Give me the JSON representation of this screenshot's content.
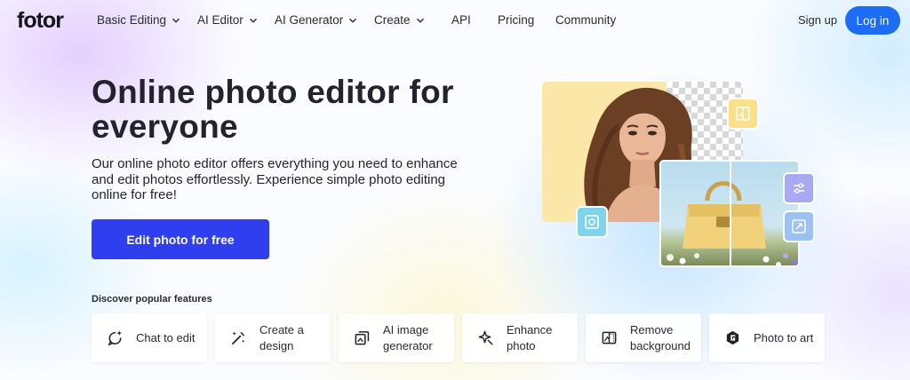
{
  "nav": {
    "logo": "fotor",
    "items": [
      {
        "label": "Basic Editing",
        "dropdown": true
      },
      {
        "label": "AI Editor",
        "dropdown": true
      },
      {
        "label": "AI Generator",
        "dropdown": true
      },
      {
        "label": "Create",
        "dropdown": true
      },
      {
        "label": "API",
        "dropdown": false
      },
      {
        "label": "Pricing",
        "dropdown": false
      },
      {
        "label": "Community",
        "dropdown": false
      }
    ],
    "signup": "Sign up",
    "login": "Log in"
  },
  "hero": {
    "title": "Online photo editor for everyone",
    "description": "Our online photo editor offers everything you need to enhance and edit photos effortlessly. Experience simple photo editing online for free!",
    "cta": "Edit photo for free"
  },
  "features": {
    "heading": "Discover popular features",
    "items": [
      {
        "label": "Chat to edit",
        "icon": "chat-sparkle-icon"
      },
      {
        "label": "Create a design",
        "icon": "magic-wand-icon"
      },
      {
        "label": "AI image generator",
        "icon": "image-stack-icon"
      },
      {
        "label": "Enhance photo",
        "icon": "enhance-sparkle-icon"
      },
      {
        "label": "Remove background",
        "icon": "remove-background-icon"
      },
      {
        "label": "Photo to art",
        "icon": "art-logo-icon"
      }
    ]
  },
  "collage": {
    "badges": [
      "cutout-icon",
      "enhance-frame-icon",
      "adjust-sliders-icon",
      "resize-icon"
    ]
  },
  "colors": {
    "primary_blue": "#1d6cf5",
    "cta_blue": "#2f3ff0",
    "text_dark": "#23232e"
  }
}
